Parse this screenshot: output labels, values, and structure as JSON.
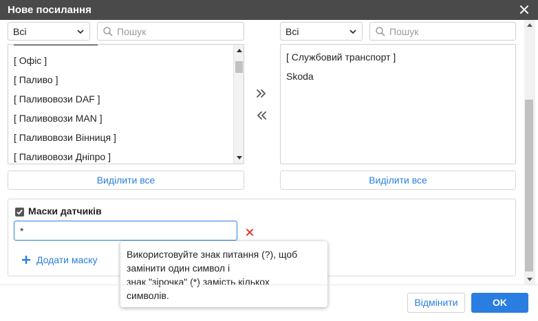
{
  "dialog": {
    "title": "Нове посилання"
  },
  "left": {
    "filter_value": "Всі",
    "search_placeholder": "Пошук",
    "items": [
      "[ Офіс ]",
      "[ Паливо ]",
      "[ Паливовози DAF ]",
      "[ Паливовози MAN ]",
      "[ Паливовози Вінниця ]",
      "[ Паливовози Дніпро ]"
    ],
    "select_all_label": "Виділити все"
  },
  "right": {
    "filter_value": "Всі",
    "search_placeholder": "Пошук",
    "items": [
      "[ Службовий транспорт ]",
      "Skoda"
    ],
    "select_all_label": "Виділити все"
  },
  "transfer": {
    "move_right_icon": "double-chevron-right-icon",
    "move_left_icon": "double-chevron-left-icon"
  },
  "masks": {
    "checkbox_checked": true,
    "label": "Маски датчиків",
    "value": "*",
    "add_label": "Додати маску"
  },
  "tooltip": {
    "lines": [
      "Використовуйте знак питання (?), щоб",
      "замінити один символ і",
      "знак \"зірочка\" (*) замість кількох",
      "символів."
    ]
  },
  "footer": {
    "cancel_label": "Відмінити",
    "ok_label": "OK"
  },
  "colors": {
    "accent": "#2a7de1",
    "titlebar": "#4a4a4a",
    "danger": "#e53935"
  }
}
